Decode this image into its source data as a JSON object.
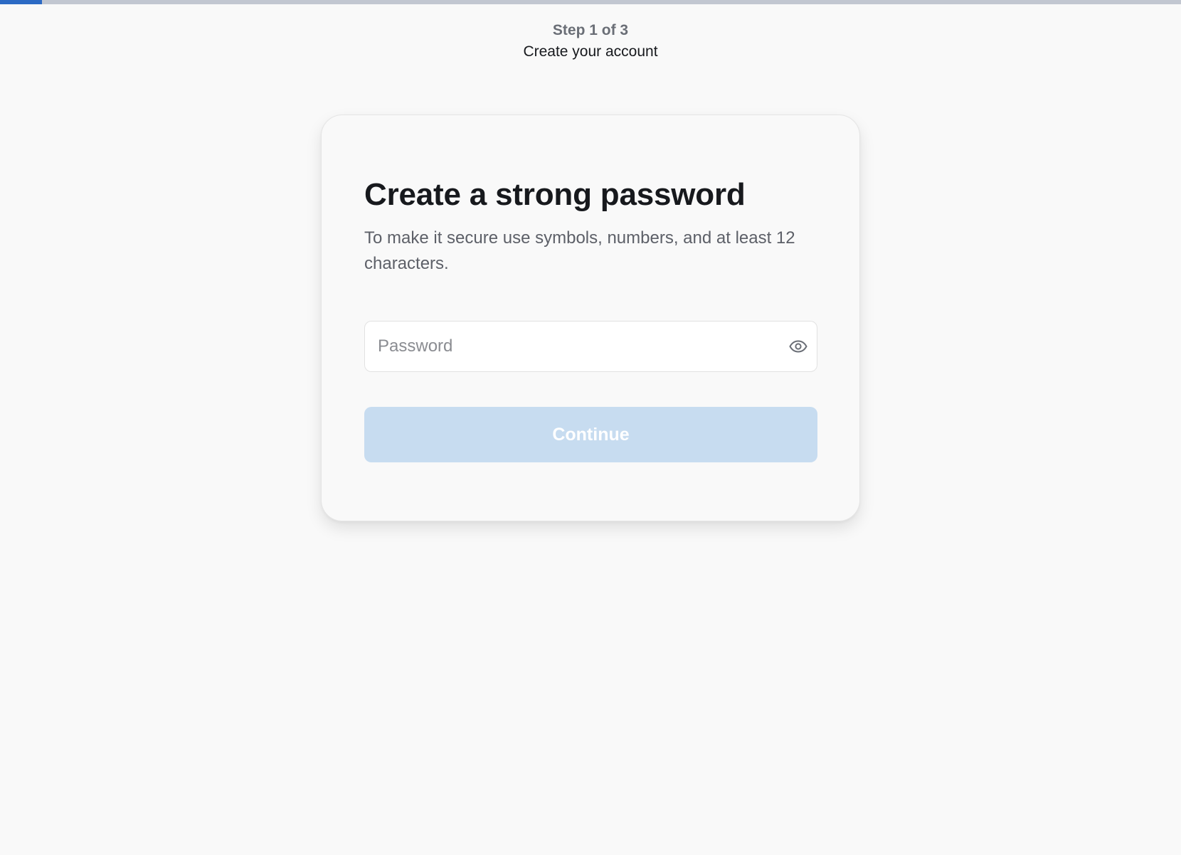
{
  "progress": {
    "fraction": 0.0355,
    "track_color": "#c2c7d1",
    "fill_color": "#2c6ac4"
  },
  "header": {
    "step_label": "Step 1 of 3",
    "title": "Create your account"
  },
  "card": {
    "title": "Create a strong password",
    "description": "To make it secure use symbols, numbers, and at least 12 characters.",
    "password_field": {
      "value": "",
      "placeholder": "Password",
      "toggle_icon": "eye-icon"
    },
    "continue_button": {
      "label": "Continue",
      "state": "disabled",
      "color": "#c7dcf0"
    }
  }
}
